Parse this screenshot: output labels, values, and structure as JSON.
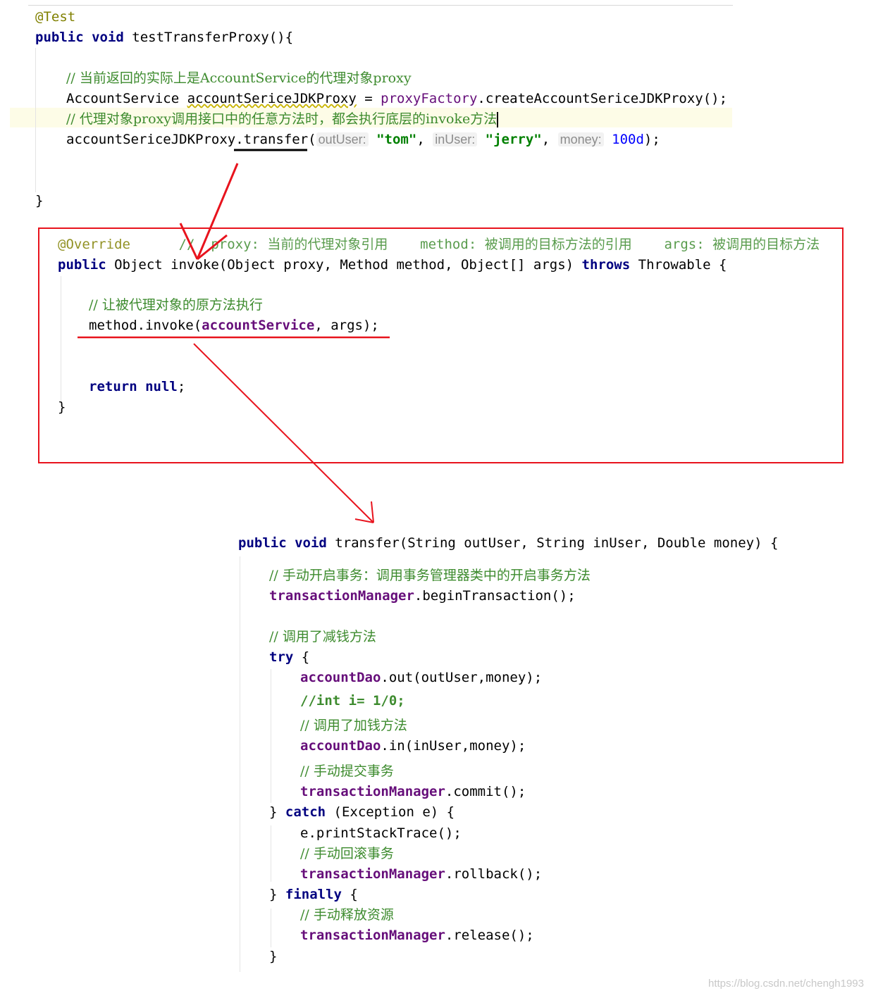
{
  "test_method": {
    "annotation": "@Test",
    "decl_kw": "public void",
    "decl_rest": " testTransferProxy(){",
    "comment1": "// 当前返回的实际上是AccountService的代理对象proxy",
    "line2_type": "AccountService ",
    "line2_var": "accountSericeJDKProxy",
    "line2_eq": " = ",
    "line2_field": "proxyFactory",
    "line2_call": ".createAccountSericeJDKProxy();",
    "comment2": "// 代理对象proxy调用接口中的任意方法时，都会执行底层的invoke方法",
    "call_obj": "accountSericeJDKProxy.",
    "call_method": "transfer(",
    "hint_outUser": "outUser:",
    "arg_tom": "\"tom\"",
    "comma1": ", ",
    "hint_inUser": "inUser:",
    "arg_jerry": "\"jerry\"",
    "comma2": ", ",
    "hint_money": "money:",
    "arg_money": "100d",
    "call_end": ");",
    "close": "}"
  },
  "invoke_method": {
    "annotation": "@Override",
    "param_comment": "//  proxy: 当前的代理对象引用    method: 被调用的目标方法的引用    args: 被调用的目标方法",
    "decl_kw": "public",
    "decl_mid": " Object invoke(Object proxy, Method method, Object[] args) ",
    "throws_kw": "throws",
    "decl_end": " Throwable {",
    "comment": "// 让被代理对象的原方法执行",
    "invoke_pre": "method.invoke(",
    "invoke_field": "accountService",
    "invoke_end": ", args);",
    "return_kw": "return null",
    "return_end": ";",
    "close": "}"
  },
  "transfer_method": {
    "decl_kw": "public void",
    "decl_rest": " transfer(String outUser, String inUser, Double money) {",
    "comment_begin": "// 手动开启事务：调用事务管理器类中的开启事务方法",
    "tm": "transactionManager",
    "begin_call": ".beginTransaction();",
    "comment_out": "// 调用了减钱方法",
    "try_kw": "try",
    "try_brace": " {",
    "dao": "accountDao",
    "out_call": ".out(outUser,money);",
    "commented_code": "//int i= 1/0;",
    "comment_in": "// 调用了加钱方法",
    "in_call": ".in(inUser,money);",
    "comment_commit": "// 手动提交事务",
    "commit_call": ".commit();",
    "catch_pre": "} ",
    "catch_kw": "catch",
    "catch_rest": " (Exception e) {",
    "print_call": "e.printStackTrace();",
    "comment_rollback": "// 手动回滚事务",
    "rollback_call": ".rollback();",
    "finally_pre": "} ",
    "finally_kw": "finally",
    "finally_brace": " {",
    "comment_release": "// 手动释放资源",
    "release_call": ".release();",
    "close": "}"
  },
  "watermark": "https://blog.csdn.net/chengh1993",
  "colors": {
    "keyword": "#000080",
    "comment": "#3d8b2e",
    "field": "#660e7a",
    "annotation": "#808000",
    "string": "#008000",
    "number": "#0000ff",
    "annotation_red": "#e8131d"
  }
}
